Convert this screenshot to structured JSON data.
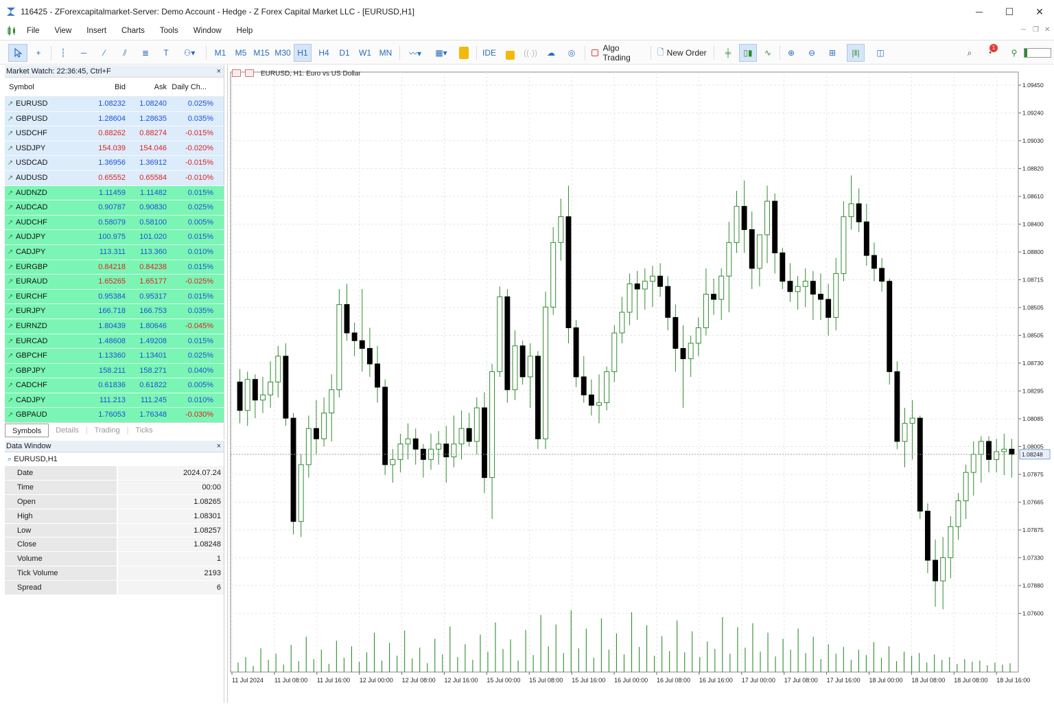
{
  "window": {
    "title": "116425 - ZForexcapitalmarket-Server: Demo Account - Hedge - Z Forex Capital Market LLC - [EURUSD,H1]",
    "minimize_icon": "minimize-icon",
    "maximize_icon": "maximize-icon",
    "close_icon": "close-icon"
  },
  "menu": [
    "File",
    "View",
    "Insert",
    "Charts",
    "Tools",
    "Window",
    "Help"
  ],
  "toolbar": {
    "timeframes": [
      "M1",
      "M5",
      "M15",
      "M30",
      "H1",
      "H4",
      "D1",
      "W1",
      "MN"
    ],
    "active_timeframe": "H1",
    "ide_label": "IDE",
    "algo_trading_label": "Algo Trading",
    "new_order_label": "New Order",
    "notification_count": "1"
  },
  "market_watch": {
    "title": "Market Watch: 22:36:45, Ctrl+F",
    "columns": [
      "Symbol",
      "Bid",
      "Ask",
      "Daily Ch..."
    ],
    "rows": [
      {
        "symbol": "EURUSD",
        "bid": "1.08232",
        "ask": "1.08240",
        "change": "0.025%",
        "bid_color": "blue",
        "change_color": "blue"
      },
      {
        "symbol": "GBPUSD",
        "bid": "1.28604",
        "ask": "1.28635",
        "change": "0.035%",
        "bid_color": "blue",
        "change_color": "blue"
      },
      {
        "symbol": "USDCHF",
        "bid": "0.88262",
        "ask": "0.88274",
        "change": "-0.015%",
        "bid_color": "red",
        "change_color": "red"
      },
      {
        "symbol": "USDJPY",
        "bid": "154.039",
        "ask": "154.046",
        "change": "-0.020%",
        "bid_color": "red",
        "change_color": "red"
      },
      {
        "symbol": "USDCAD",
        "bid": "1.36956",
        "ask": "1.36912",
        "change": "-0.015%",
        "bid_color": "blue",
        "change_color": "red"
      },
      {
        "symbol": "AUDUSD",
        "bid": "0.65552",
        "ask": "0.65584",
        "change": "-0.010%",
        "bid_color": "red",
        "change_color": "red"
      },
      {
        "symbol": "AUDNZD",
        "bid": "1.11459",
        "ask": "1.11482",
        "change": "0.015%",
        "bid_color": "blue",
        "change_color": "blue"
      },
      {
        "symbol": "AUDCAD",
        "bid": "0.90787",
        "ask": "0.90830",
        "change": "0.025%",
        "bid_color": "blue",
        "change_color": "blue"
      },
      {
        "symbol": "AUDCHF",
        "bid": "0.58079",
        "ask": "0.58100",
        "change": "0.005%",
        "bid_color": "blue",
        "change_color": "blue"
      },
      {
        "symbol": "AUDJPY",
        "bid": "100.975",
        "ask": "101.020",
        "change": "0.015%",
        "bid_color": "blue",
        "change_color": "blue"
      },
      {
        "symbol": "CADJPY",
        "bid": "113.311",
        "ask": "113.360",
        "change": "0.010%",
        "bid_color": "blue",
        "change_color": "blue"
      },
      {
        "symbol": "EURGBP",
        "bid": "0.84218",
        "ask": "0.84238",
        "change": "0.015%",
        "bid_color": "red",
        "change_color": "blue"
      },
      {
        "symbol": "EURAUD",
        "bid": "1.65265",
        "ask": "1.65177",
        "change": "-0.025%",
        "bid_color": "red",
        "change_color": "red"
      },
      {
        "symbol": "EURCHF",
        "bid": "0.95384",
        "ask": "0.95317",
        "change": "0.015%",
        "bid_color": "blue",
        "change_color": "blue"
      },
      {
        "symbol": "EURJPY",
        "bid": "166.718",
        "ask": "166.753",
        "change": "0.035%",
        "bid_color": "blue",
        "change_color": "blue"
      },
      {
        "symbol": "EURNZD",
        "bid": "1.80439",
        "ask": "1.80646",
        "change": "-0.045%",
        "bid_color": "blue",
        "change_color": "red"
      },
      {
        "symbol": "EURCAD",
        "bid": "1.48608",
        "ask": "1.49208",
        "change": "0.015%",
        "bid_color": "blue",
        "change_color": "blue"
      },
      {
        "symbol": "GBPCHF",
        "bid": "1.13360",
        "ask": "1.13401",
        "change": "0.025%",
        "bid_color": "blue",
        "change_color": "blue"
      },
      {
        "symbol": "GBPJPY",
        "bid": "158.211",
        "ask": "158.271",
        "change": "0.040%",
        "bid_color": "blue",
        "change_color": "blue"
      },
      {
        "symbol": "CADCHF",
        "bid": "0.61836",
        "ask": "0.61822",
        "change": "0.005%",
        "bid_color": "blue",
        "change_color": "blue"
      },
      {
        "symbol": "CADJPY",
        "bid": "111.213",
        "ask": "111.245",
        "change": "0.010%",
        "bid_color": "blue",
        "change_color": "blue"
      },
      {
        "symbol": "GBPAUD",
        "bid": "1.76053",
        "ask": "1.76348",
        "change": "-0.030%",
        "bid_color": "blue",
        "change_color": "red"
      }
    ],
    "tabs": [
      "Symbols",
      "Details",
      "Trading",
      "Ticks"
    ],
    "active_tab": "Symbols"
  },
  "data_window": {
    "title": "Data Window",
    "symbol": "EURUSD,H1",
    "rows": [
      {
        "key": "Date",
        "value": "2024.07.24"
      },
      {
        "key": "Time",
        "value": "00:00"
      },
      {
        "key": "Open",
        "value": "1.08265"
      },
      {
        "key": "High",
        "value": "1.08301"
      },
      {
        "key": "Low",
        "value": "1.08257"
      },
      {
        "key": "Close",
        "value": "1.08248"
      },
      {
        "key": "Volume",
        "value": "1"
      },
      {
        "key": "Tick Volume",
        "value": "2193"
      },
      {
        "key": "Spread",
        "value": "6"
      }
    ]
  },
  "chart_data": {
    "type": "candlestick",
    "title": "EURUSD, H1:  Euro vs US Dollar",
    "ylim": [
      1.0754,
      1.0952
    ],
    "y_ticks": [
      "1.09450",
      "1.09240",
      "1.09030",
      "1.08820",
      "1.08610",
      "1.08400",
      "1.08800",
      "1.08715",
      "1.08505",
      "1.08505",
      "1.08730",
      "1.08295",
      "1.08085",
      "1.08005",
      "1.07875",
      "1.07665",
      "1.07875",
      "1.07330",
      "1.07880",
      "1.07600"
    ],
    "x_ticks": [
      "11 Jul 2024",
      "11 Jul 08:00",
      "11 Jul 16:00",
      "12 Jul 00:00",
      "12 Jul 08:00",
      "12 Jul 16:00",
      "15 Jul 00:00",
      "15 Jul 08:00",
      "15 Jul 16:00",
      "16 Jul 00:00",
      "16 Jul 08:00",
      "16 Jul 16:00",
      "17 Jul 00:00",
      "17 Jul 08:00",
      "17 Jul 16:00",
      "18 Jul 00:00",
      "18 Jul 08:00",
      "18 Jul 08:00",
      "18 Jul 16:00"
    ],
    "current_price": "1.08248",
    "up_color": "#ffffff",
    "down_color": "#000000",
    "wick_color": "#2e8b2e",
    "volume_color": "#2e8b2e",
    "candles": [
      [
        1.0836,
        1.0841,
        1.082,
        1.0825
      ],
      [
        1.0825,
        1.084,
        1.0819,
        1.0837
      ],
      [
        1.0837,
        1.0839,
        1.0822,
        1.0829
      ],
      [
        1.0829,
        1.0838,
        1.0824,
        1.0831
      ],
      [
        1.0831,
        1.0844,
        1.0826,
        1.0836
      ],
      [
        1.0836,
        1.085,
        1.083,
        1.0846
      ],
      [
        1.0846,
        1.0851,
        1.0819,
        1.0822
      ],
      [
        1.0822,
        1.0824,
        1.0777,
        1.0782
      ],
      [
        1.0782,
        1.0808,
        1.0776,
        1.0804
      ],
      [
        1.0804,
        1.0823,
        1.0799,
        1.0818
      ],
      [
        1.0818,
        1.0829,
        1.0808,
        1.0814
      ],
      [
        1.0814,
        1.083,
        1.0811,
        1.0824
      ],
      [
        1.0824,
        1.0839,
        1.0813,
        1.0833
      ],
      [
        1.0833,
        1.0872,
        1.083,
        1.0866
      ],
      [
        1.0866,
        1.0874,
        1.0852,
        1.0855
      ],
      [
        1.0855,
        1.0859,
        1.0846,
        1.0852
      ],
      [
        1.0852,
        1.0872,
        1.084,
        1.0849
      ],
      [
        1.0849,
        1.0857,
        1.0838,
        1.0843
      ],
      [
        1.0843,
        1.085,
        1.0828,
        1.0834
      ],
      [
        1.0834,
        1.0837,
        1.08,
        1.0804
      ],
      [
        1.0804,
        1.081,
        1.0797,
        1.0806
      ],
      [
        1.0806,
        1.0816,
        1.0801,
        1.0812
      ],
      [
        1.0812,
        1.082,
        1.0806,
        1.0814
      ],
      [
        1.0814,
        1.0818,
        1.0804,
        1.081
      ],
      [
        1.081,
        1.0812,
        1.0799,
        1.0806
      ],
      [
        1.0806,
        1.0816,
        1.0802,
        1.081
      ],
      [
        1.081,
        1.0817,
        1.0804,
        1.0812
      ],
      [
        1.0812,
        1.0819,
        1.0797,
        1.0807
      ],
      [
        1.0807,
        1.0823,
        1.0803,
        1.0812
      ],
      [
        1.0812,
        1.0825,
        1.0806,
        1.0818
      ],
      [
        1.0818,
        1.0824,
        1.0811,
        1.0813
      ],
      [
        1.0813,
        1.083,
        1.0808,
        1.0826
      ],
      [
        1.0826,
        1.0832,
        1.0793,
        1.0799
      ],
      [
        1.0799,
        1.0843,
        1.0783,
        1.084
      ],
      [
        1.084,
        1.0873,
        1.0838,
        1.0869
      ],
      [
        1.0869,
        1.0872,
        1.0828,
        1.0833
      ],
      [
        1.0833,
        1.0856,
        1.0829,
        1.085
      ],
      [
        1.085,
        1.0852,
        1.0835,
        1.0838
      ],
      [
        1.0838,
        1.0851,
        1.0826,
        1.0846
      ],
      [
        1.0846,
        1.0848,
        1.081,
        1.0814
      ],
      [
        1.0814,
        1.0871,
        1.081,
        1.0865
      ],
      [
        1.0865,
        1.0896,
        1.0862,
        1.089
      ],
      [
        1.089,
        1.0907,
        1.0883,
        1.09
      ],
      [
        1.09,
        1.0912,
        1.0851,
        1.0857
      ],
      [
        1.0857,
        1.086,
        1.0834,
        1.0838
      ],
      [
        1.0838,
        1.0846,
        1.0828,
        1.0831
      ],
      [
        1.0831,
        1.0837,
        1.0823,
        1.0827
      ],
      [
        1.0827,
        1.0839,
        1.082,
        1.0828
      ],
      [
        1.0828,
        1.0842,
        1.0825,
        1.084
      ],
      [
        1.084,
        1.0858,
        1.0836,
        1.0855
      ],
      [
        1.0855,
        1.0869,
        1.0851,
        1.0863
      ],
      [
        1.0863,
        1.0878,
        1.0858,
        1.0874
      ],
      [
        1.0874,
        1.0879,
        1.086,
        1.0872
      ],
      [
        1.0872,
        1.088,
        1.0864,
        1.0875
      ],
      [
        1.0875,
        1.0881,
        1.0865,
        1.0877
      ],
      [
        1.0877,
        1.0882,
        1.0869,
        1.0873
      ],
      [
        1.0873,
        1.0877,
        1.0856,
        1.0861
      ],
      [
        1.0861,
        1.0866,
        1.084,
        1.0849
      ],
      [
        1.0849,
        1.0858,
        1.0826,
        1.0845
      ],
      [
        1.0845,
        1.0854,
        1.0838,
        1.0851
      ],
      [
        1.0851,
        1.0861,
        1.0846,
        1.0857
      ],
      [
        1.0857,
        1.088,
        1.0854,
        1.087
      ],
      [
        1.087,
        1.0876,
        1.0862,
        1.0868
      ],
      [
        1.0868,
        1.088,
        1.086,
        1.0877
      ],
      [
        1.0877,
        1.0898,
        1.0863,
        1.089
      ],
      [
        1.089,
        1.091,
        1.0886,
        1.0904
      ],
      [
        1.0904,
        1.0914,
        1.0886,
        1.0895
      ],
      [
        1.0895,
        1.0902,
        1.0872,
        1.088
      ],
      [
        1.088,
        1.0891,
        1.0873,
        1.0893
      ],
      [
        1.0893,
        1.0912,
        1.0882,
        1.0906
      ],
      [
        1.0906,
        1.0909,
        1.0878,
        1.0886
      ],
      [
        1.0886,
        1.0888,
        1.0872,
        1.0875
      ],
      [
        1.0875,
        1.0882,
        1.0867,
        1.0871
      ],
      [
        1.0871,
        1.0877,
        1.0864,
        1.0873
      ],
      [
        1.0873,
        1.088,
        1.0865,
        1.0875
      ],
      [
        1.0875,
        1.0879,
        1.086,
        1.087
      ],
      [
        1.087,
        1.0878,
        1.086,
        1.0868
      ],
      [
        1.0868,
        1.0874,
        1.0854,
        1.0861
      ],
      [
        1.0861,
        1.0884,
        1.0856,
        1.0878
      ],
      [
        1.0878,
        1.0906,
        1.0875,
        1.09
      ],
      [
        1.09,
        1.0916,
        1.0895,
        1.0905
      ],
      [
        1.0905,
        1.0911,
        1.0894,
        1.0898
      ],
      [
        1.0898,
        1.0905,
        1.0881,
        1.0885
      ],
      [
        1.0885,
        1.089,
        1.0875,
        1.088
      ],
      [
        1.088,
        1.0884,
        1.0871,
        1.0875
      ],
      [
        1.0875,
        1.0876,
        1.0835,
        1.084
      ],
      [
        1.084,
        1.0844,
        1.081,
        1.0813
      ],
      [
        1.0813,
        1.0826,
        1.0803,
        1.082
      ],
      [
        1.082,
        1.0829,
        1.0806,
        1.0822
      ],
      [
        1.0822,
        1.0823,
        1.0783,
        1.0786
      ],
      [
        1.0786,
        1.0789,
        1.0762,
        1.0767
      ],
      [
        1.0767,
        1.0775,
        1.0749,
        1.0759
      ],
      [
        1.0759,
        1.0776,
        1.0748,
        1.0768
      ],
      [
        1.0768,
        1.0784,
        1.076,
        1.078
      ],
      [
        1.078,
        1.0793,
        1.0775,
        1.079
      ],
      [
        1.079,
        1.0804,
        1.0783,
        1.0801
      ],
      [
        1.0801,
        1.0813,
        1.0792,
        1.0808
      ],
      [
        1.0808,
        1.0815,
        1.0797,
        1.0813
      ],
      [
        1.0813,
        1.0815,
        1.0801,
        1.0806
      ],
      [
        1.0806,
        1.0814,
        1.0801,
        1.0809
      ],
      [
        1.0809,
        1.0816,
        1.08,
        1.081
      ],
      [
        1.081,
        1.0814,
        1.0799,
        1.0808
      ]
    ],
    "volumes": [
      14,
      22,
      9,
      35,
      18,
      27,
      11,
      40,
      16,
      52,
      19,
      33,
      12,
      46,
      21,
      38,
      15,
      29,
      58,
      17,
      43,
      24,
      61,
      20,
      36,
      13,
      49,
      26,
      67,
      22,
      41,
      18,
      55,
      30,
      73,
      34,
      48,
      17,
      62,
      25,
      84,
      38,
      70,
      28,
      91,
      35,
      64,
      21,
      79,
      33,
      57,
      26,
      88,
      37,
      69,
      24,
      53,
      31,
      76,
      29,
      60,
      22,
      45,
      34,
      81,
      27,
      66,
      36,
      72,
      30,
      58,
      23,
      49,
      33,
      64,
      28,
      52,
      19,
      41,
      27,
      37,
      18,
      33,
      25,
      44,
      21,
      38,
      16,
      30,
      24,
      28,
      14,
      26,
      18,
      22,
      12,
      19,
      15,
      17,
      10,
      14,
      11,
      13
    ]
  }
}
